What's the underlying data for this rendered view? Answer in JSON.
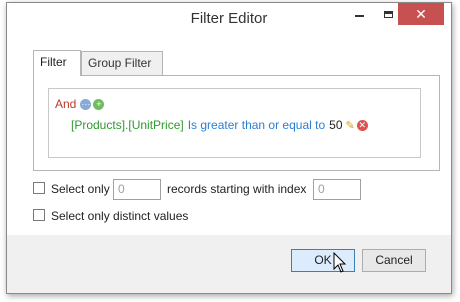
{
  "window": {
    "title": "Filter Editor",
    "close_glyph": "✕"
  },
  "tabs": [
    {
      "label": "Filter",
      "active": true
    },
    {
      "label": "Group Filter",
      "active": false
    }
  ],
  "filter": {
    "group_operator": "And",
    "condition": {
      "field": "[Products].[UnitPrice]",
      "operator": "Is greater than or equal to",
      "value": "50"
    }
  },
  "options": {
    "select_only_label": "Select only",
    "select_only_count": "0",
    "records_label": "records starting with index",
    "start_index": "0",
    "distinct_label": "Select only distinct values"
  },
  "buttons": {
    "ok": "OK",
    "cancel": "Cancel"
  },
  "colors": {
    "group_operator": "#c0392b",
    "field": "#2e9a2e",
    "operator": "#2a7fd4",
    "close_button": "#c75050"
  }
}
